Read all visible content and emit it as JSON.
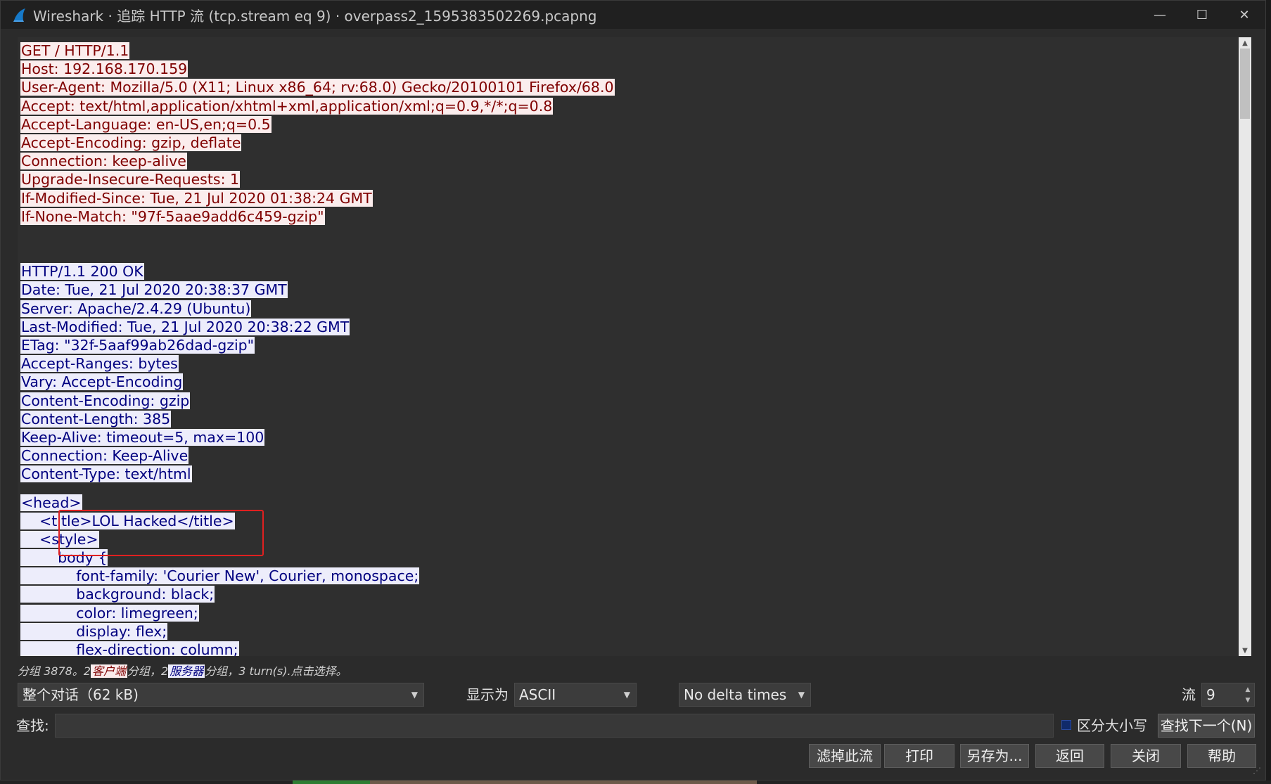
{
  "window": {
    "title": "Wireshark · 追踪 HTTP 流 (tcp.stream eq 9) · overpass2_1595383502269.pcapng",
    "controls": {
      "minimize": "—",
      "maximize": "☐",
      "close": "✕"
    }
  },
  "stream": {
    "request": [
      "GET / HTTP/1.1",
      "Host: 192.168.170.159",
      "User-Agent: Mozilla/5.0 (X11; Linux x86_64; rv:68.0) Gecko/20100101 Firefox/68.0",
      "Accept: text/html,application/xhtml+xml,application/xml;q=0.9,*/*;q=0.8",
      "Accept-Language: en-US,en;q=0.5",
      "Accept-Encoding: gzip, deflate",
      "Connection: keep-alive",
      "Upgrade-Insecure-Requests: 1",
      "If-Modified-Since: Tue, 21 Jul 2020 01:38:24 GMT",
      "If-None-Match: \"97f-5aae9add6c459-gzip\""
    ],
    "response_headers": [
      "HTTP/1.1 200 OK",
      "Date: Tue, 21 Jul 2020 20:38:37 GMT",
      "Server: Apache/2.4.29 (Ubuntu)",
      "Last-Modified: Tue, 21 Jul 2020 20:38:22 GMT",
      "ETag: \"32f-5aaf99ab26dad-gzip\"",
      "Accept-Ranges: bytes",
      "Vary: Accept-Encoding",
      "Content-Encoding: gzip",
      "Content-Length: 385",
      "Keep-Alive: timeout=5, max=100",
      "Connection: Keep-Alive",
      "Content-Type: text/html"
    ],
    "response_body": [
      "<head>",
      "    <title>LOL Hacked</title>",
      "    <style>",
      "        body {",
      "            font-family: 'Courier New', Courier, monospace;",
      "            background: black;",
      "            color: limegreen;",
      "            display: flex;",
      "            flex-direction: column;"
    ]
  },
  "status": {
    "prefix": "分组 3878。2",
    "client_label": "客户端",
    "middle": "分组，2",
    "server_label": "服务器",
    "suffix": "分组，3 turn(s).点击选择。"
  },
  "controls": {
    "conversation_select": "整个对话（62 kB)",
    "show_as_label": "显示为",
    "show_as_value": "ASCII",
    "delta_select": "No delta times",
    "stream_label": "流",
    "stream_value": "9"
  },
  "find": {
    "label": "查找:",
    "value": "",
    "case_sensitive_label": "区分大小写",
    "find_next_button": "查找下一个(N)"
  },
  "buttons": {
    "filter_out": "滤掉此流",
    "print": "打印",
    "save_as": "另存为...",
    "back": "返回",
    "close": "关闭",
    "help": "帮助"
  },
  "colors": {
    "client_bg": "#fbeded",
    "client_fg": "#7f0000",
    "server_bg": "#ededfb",
    "server_fg": "#00007f",
    "highlight_box": "#e02020",
    "window_bg": "#2b2b2b"
  }
}
